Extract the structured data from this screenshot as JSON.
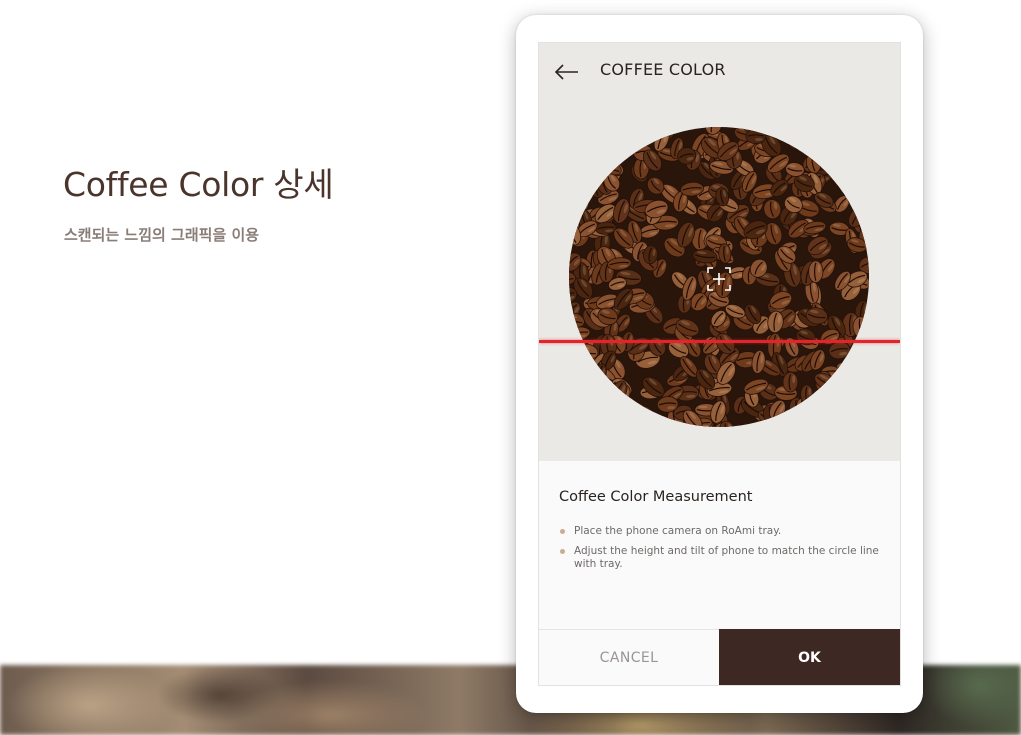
{
  "intro": {
    "title": "Coffee Color 상세",
    "subtitle": "스캔되는 느낌의 그래픽을 이용"
  },
  "app": {
    "back_icon": "arrow-left-icon",
    "header_title": "COFFEE COLOR",
    "focus_icon": "focus-plus-icon"
  },
  "info": {
    "title": "Coffee Color Measurement",
    "items": [
      "Place the phone camera on RoAmi tray.",
      "Adjust the height and tilt of phone to match the circle line with tray."
    ]
  },
  "actions": {
    "cancel_label": "CANCEL",
    "ok_label": "OK"
  },
  "colors": {
    "brand_dark": "#3d2823",
    "scan_line": "#e0262a",
    "bullet": "#c7ad94",
    "title_text": "#4a342b"
  }
}
